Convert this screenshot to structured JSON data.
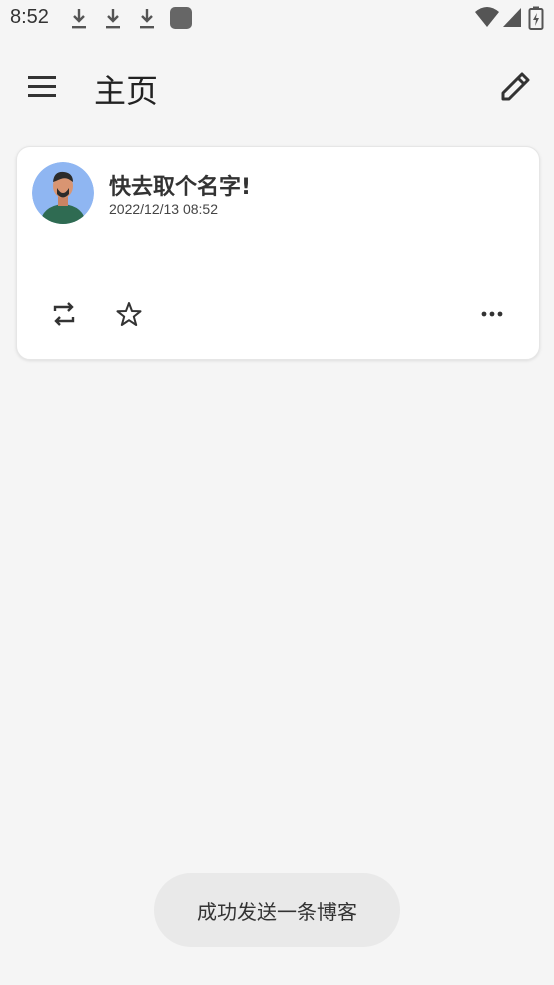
{
  "status_bar": {
    "time": "8:52",
    "notification_icons": [
      "download-icon",
      "download-icon",
      "download-icon",
      "app-icon"
    ],
    "system_icons": [
      "wifi-icon",
      "cellular-signal-icon",
      "battery-charging-icon"
    ]
  },
  "app_bar": {
    "menu_icon": "menu-icon",
    "title": "主页",
    "edit_icon": "edit-pencil-icon"
  },
  "post": {
    "author_name": "快去取个名字!",
    "timestamp": "2022/12/13 08:52",
    "body": "",
    "actions": {
      "repost_icon": "repost-icon",
      "favorite_icon": "star-outline-icon",
      "more_icon": "more-horizontal-icon"
    }
  },
  "toast": {
    "message": "成功发送一条博客"
  },
  "colors": {
    "background": "#f5f5f5",
    "card": "#ffffff",
    "toast_background": "#e9e9e9",
    "avatar_background": "#8fb6f2",
    "avatar_shirt": "#2f6b52"
  }
}
